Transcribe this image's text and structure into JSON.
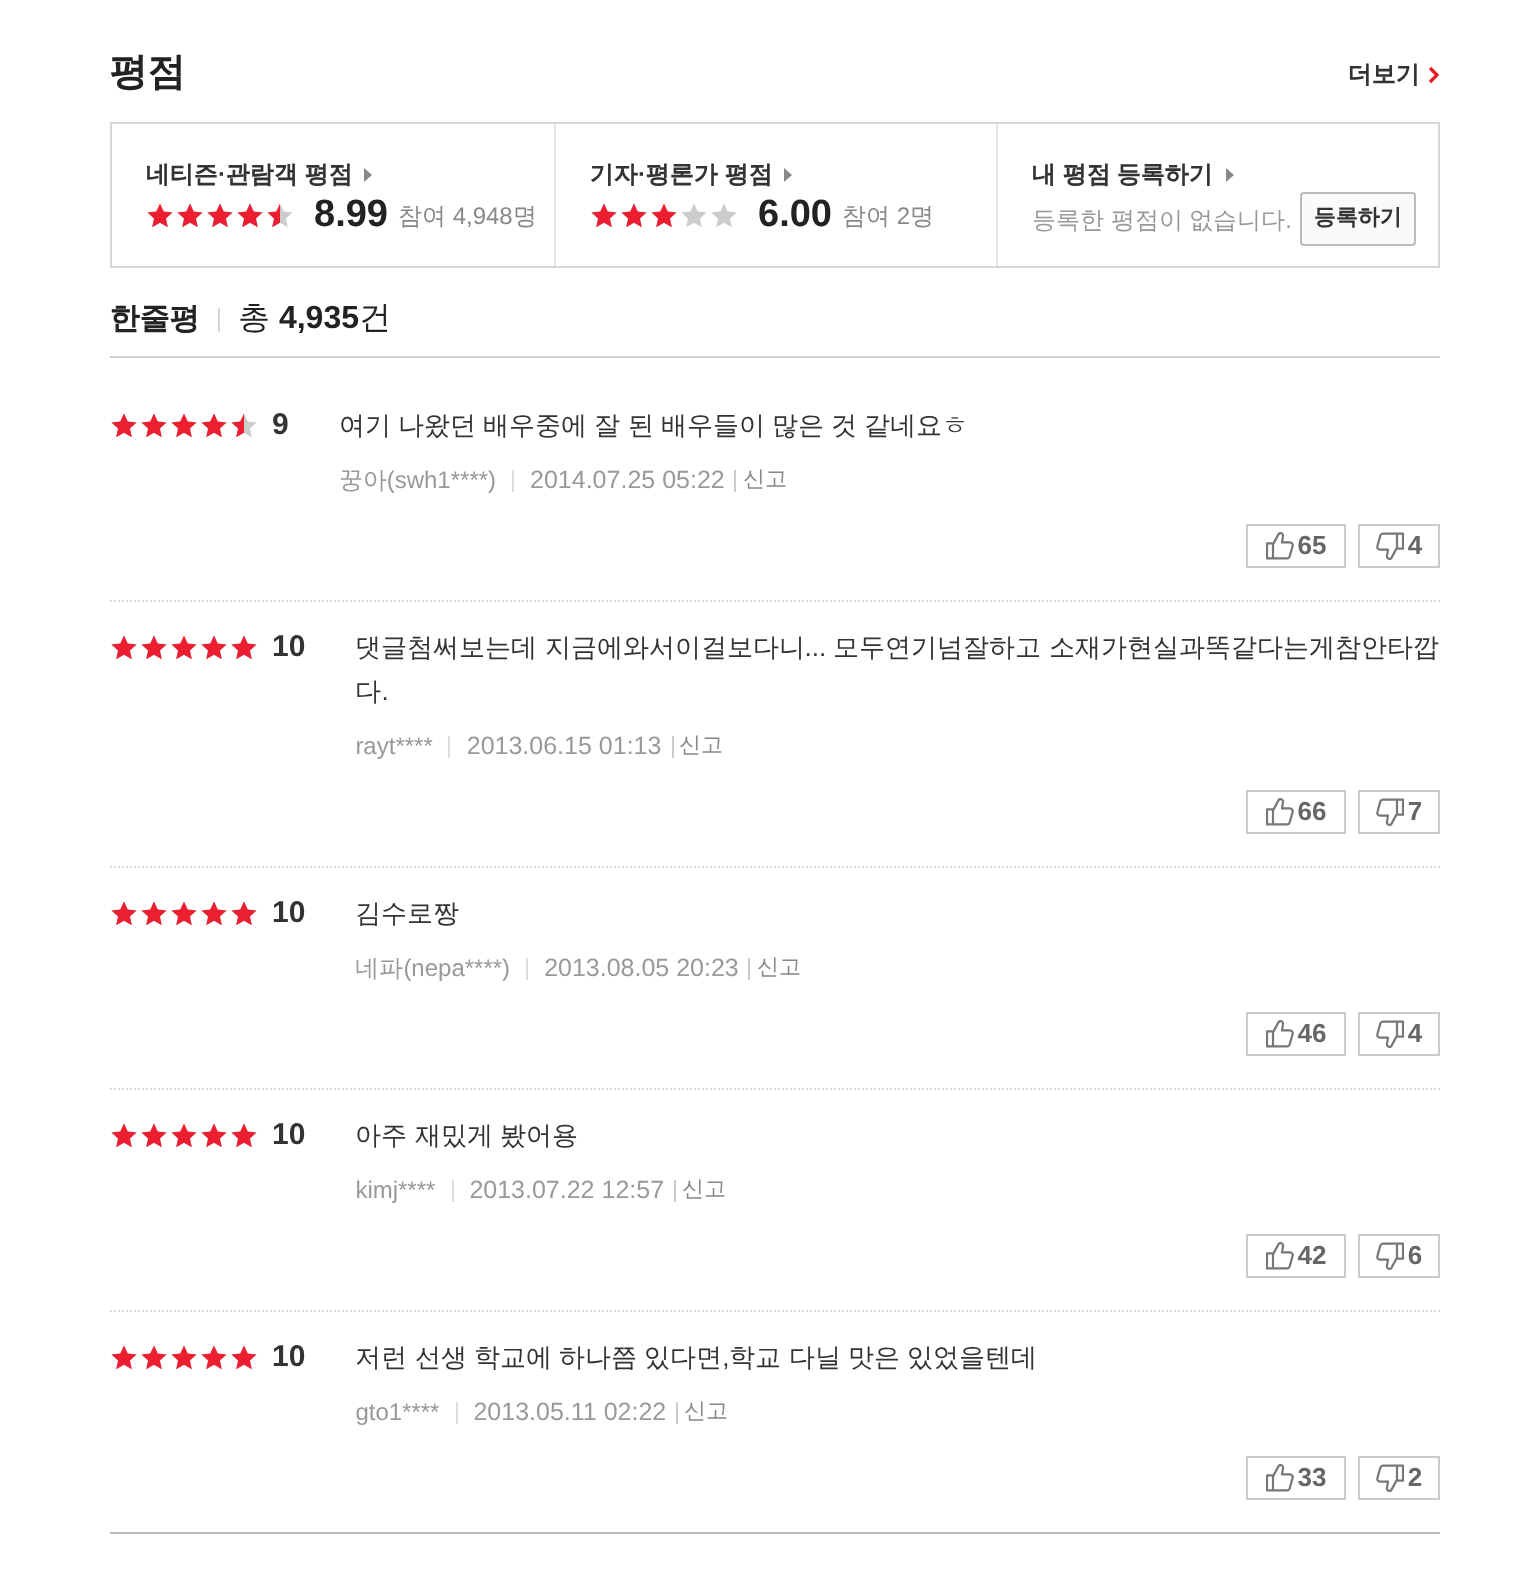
{
  "section": {
    "title": "평점",
    "more_link": "더보기"
  },
  "summary": [
    {
      "kind": "rating",
      "title": "네티즌·관람객 평점",
      "stars": 4.5,
      "score": "8.99",
      "participants": "참여 4,948명"
    },
    {
      "kind": "rating",
      "title": "기자·평론가 평점",
      "stars": 3,
      "score": "6.00",
      "participants": "참여 2명"
    },
    {
      "kind": "register",
      "title": "내 평점 등록하기",
      "message": "등록한 평점이 없습니다.",
      "button": "등록하기"
    }
  ],
  "reviews_header": {
    "title": "한줄평",
    "total": "총 **4,935**건"
  },
  "reviews": [
    {
      "stars": 4.5,
      "score": "9",
      "text": "여기 나왔던 배우중에 잘 된 배우들이 많은 것 같네요ㅎ",
      "author": "꿍아(swh1****)",
      "date": "2014.07.25 05:22",
      "report": "신고",
      "likes": "65",
      "dislikes": "4"
    },
    {
      "stars": 5,
      "score": "10",
      "text": "댓글첨써보는데 지금에와서이걸보다니... 모두연기넘잘하고 소재가현실과똑같다는게참안타깝다.",
      "author": "rayt****",
      "date": "2013.06.15 01:13",
      "report": "신고",
      "likes": "66",
      "dislikes": "7"
    },
    {
      "stars": 5,
      "score": "10",
      "text": "김수로짱",
      "author": "네파(nepa****)",
      "date": "2013.08.05 20:23",
      "report": "신고",
      "likes": "46",
      "dislikes": "4"
    },
    {
      "stars": 5,
      "score": "10",
      "text": "아주 재밌게 봤어용",
      "author": "kimj****",
      "date": "2013.07.22 12:57",
      "report": "신고",
      "likes": "42",
      "dislikes": "6"
    },
    {
      "stars": 5,
      "score": "10",
      "text": "저런 선생 학교에 하나쯤 있다면,학교 다닐 맛은 있었을텐데",
      "author": "gto1****",
      "date": "2013.05.11 02:22",
      "report": "신고",
      "likes": "33",
      "dislikes": "2"
    }
  ]
}
